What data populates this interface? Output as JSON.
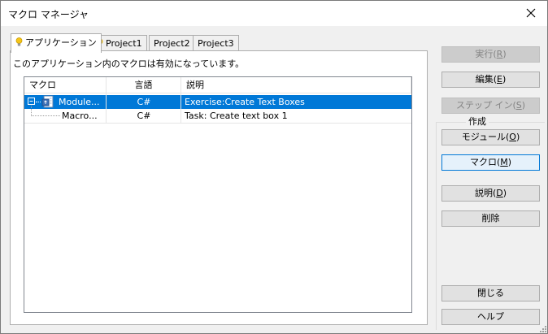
{
  "window": {
    "title": "マクロ マネージャ"
  },
  "tabs": [
    {
      "label": "アプリケーション",
      "icon": "bulb-icon",
      "active": true
    },
    {
      "label": "Project1",
      "icon": "bulb-icon",
      "active": false
    },
    {
      "label": "Project2",
      "active": false
    },
    {
      "label": "Project3",
      "active": false
    }
  ],
  "info_text": "このアプリケーション内のマクロは有効になっています。",
  "columns": {
    "macro": "マクロ",
    "language": "言語",
    "description": "説明"
  },
  "rows": [
    {
      "name": "Module...",
      "language": "C#",
      "description": "Exercise:Create Text Boxes",
      "selected": true,
      "expander": "⊟",
      "icon": "module-icon"
    },
    {
      "name": "Macro...",
      "language": "C#",
      "description": "Task: Create text box 1",
      "selected": false
    }
  ],
  "buttons": {
    "run": {
      "text": "実行(",
      "key": "R",
      "close": ")",
      "disabled": true
    },
    "edit": {
      "text": "編集(",
      "key": "E",
      "close": ")",
      "disabled": false
    },
    "step_in": {
      "text": "ステップ イン(",
      "key": "S",
      "close": ")",
      "disabled": true
    },
    "create_group_label": "作成",
    "module": {
      "text": "モジュール(",
      "key": "O",
      "close": ")",
      "disabled": false
    },
    "macro": {
      "text": "マクロ(",
      "key": "M",
      "close": ")",
      "disabled": false,
      "focused": true
    },
    "description": {
      "text": "説明(",
      "key": "D",
      "close": ")",
      "disabled": false
    },
    "delete": {
      "text": "削除",
      "disabled": false
    },
    "close": {
      "text": "閉じる",
      "disabled": false
    },
    "help": {
      "text": "ヘルプ",
      "disabled": false
    }
  },
  "colors": {
    "selection": "#0078d7",
    "window_bg": "#f0f0f0",
    "disabled_text": "#838383"
  }
}
